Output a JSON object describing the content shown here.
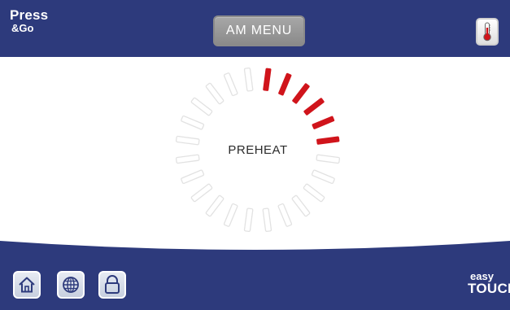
{
  "header": {
    "brand_line1": "Press",
    "brand_line2": "&Go",
    "menu_label": "AM MENU",
    "temperature_icon": "thermometer-icon"
  },
  "main": {
    "status": "PREHEAT",
    "progress": {
      "total_segments": 24,
      "active_segments": 6,
      "fraction": 0.25
    }
  },
  "footer": {
    "buttons": [
      {
        "name": "home",
        "icon": "home-icon"
      },
      {
        "name": "language",
        "icon": "globe-icon"
      },
      {
        "name": "lock",
        "icon": "lock-icon"
      }
    ],
    "logo_line1": "easy",
    "logo_line2": "TOUCH"
  },
  "colors": {
    "bar": "#2d3a7c",
    "active_segment": "#d0141b",
    "inactive_segment": "#e2e2e2",
    "button_gray": "#9a9a9a"
  }
}
